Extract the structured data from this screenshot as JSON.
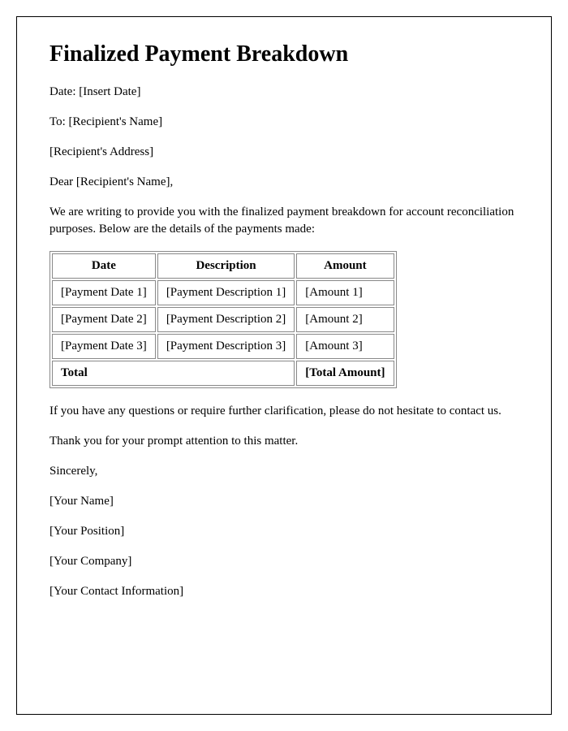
{
  "title": "Finalized Payment Breakdown",
  "date_line": "Date: [Insert Date]",
  "to_line": "To: [Recipient's Name]",
  "address_line": "[Recipient's Address]",
  "salutation": "Dear [Recipient's Name],",
  "intro": "We are writing to provide you with the finalized payment breakdown for account reconciliation purposes. Below are the details of the payments made:",
  "table": {
    "headers": {
      "date": "Date",
      "description": "Description",
      "amount": "Amount"
    },
    "rows": [
      {
        "date": "[Payment Date 1]",
        "description": "[Payment Description 1]",
        "amount": "[Amount 1]"
      },
      {
        "date": "[Payment Date 2]",
        "description": "[Payment Description 2]",
        "amount": "[Amount 2]"
      },
      {
        "date": "[Payment Date 3]",
        "description": "[Payment Description 3]",
        "amount": "[Amount 3]"
      }
    ],
    "total_label": "Total",
    "total_amount": "[Total Amount]"
  },
  "closing1": "If you have any questions or require further clarification, please do not hesitate to contact us.",
  "closing2": "Thank you for your prompt attention to this matter.",
  "signoff": "Sincerely,",
  "sender_name": "[Your Name]",
  "sender_position": "[Your Position]",
  "sender_company": "[Your Company]",
  "sender_contact": "[Your Contact Information]"
}
